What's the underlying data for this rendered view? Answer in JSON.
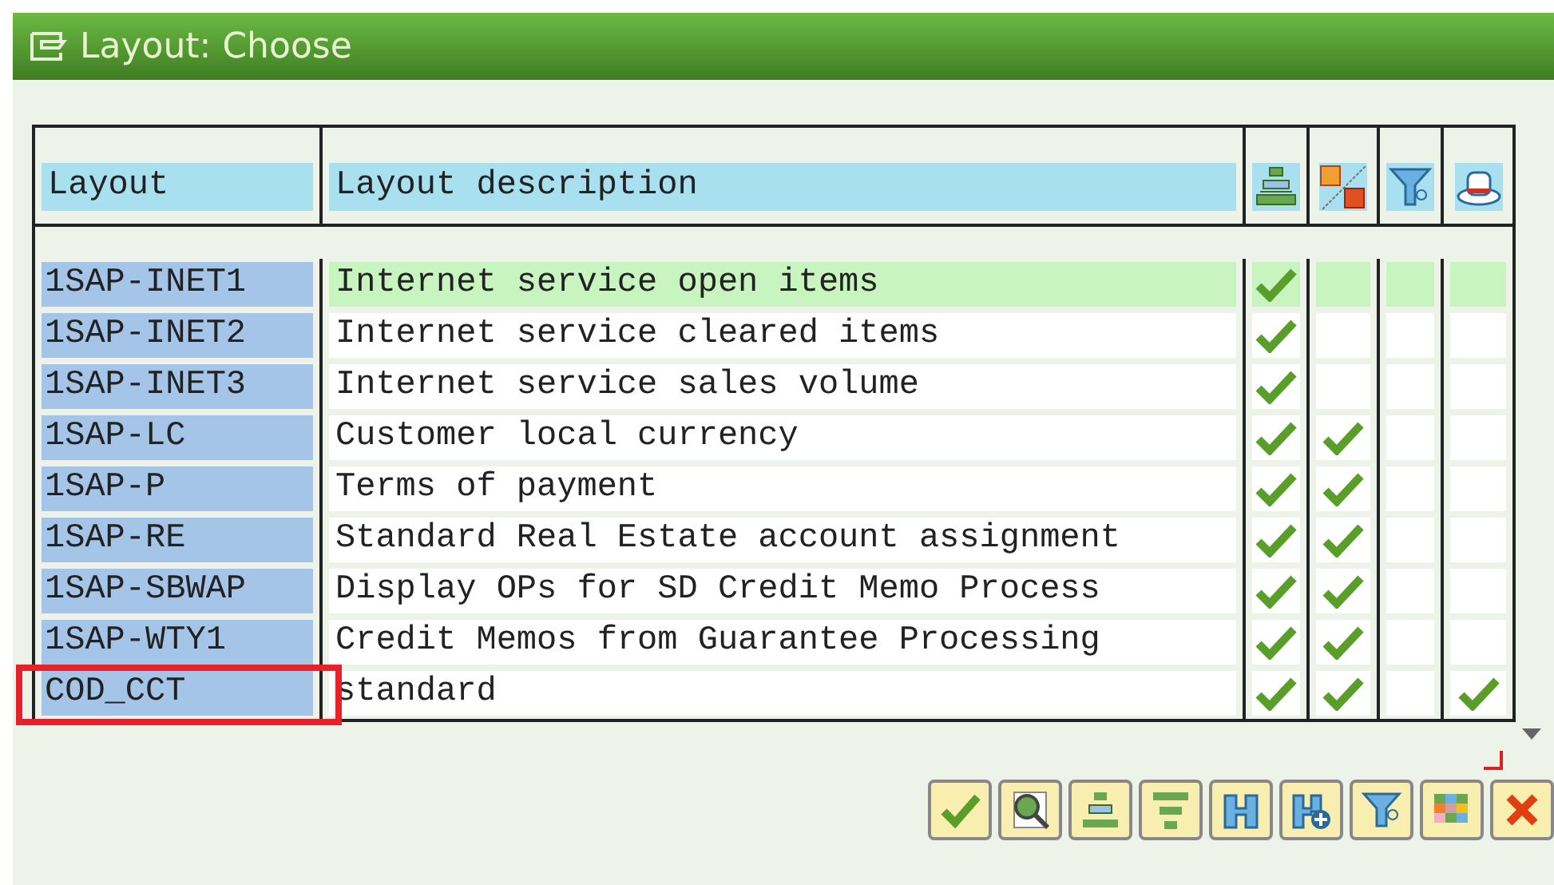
{
  "window": {
    "title": "Layout: Choose"
  },
  "table": {
    "columns": [
      "Layout",
      "Layout description"
    ],
    "rows": [
      {
        "layout": "1SAP-INET1",
        "description": "Internet service open items",
        "selected": true,
        "marked": false,
        "checks": [
          true,
          false,
          false,
          false
        ]
      },
      {
        "layout": "1SAP-INET2",
        "description": "Internet service cleared items",
        "selected": false,
        "marked": false,
        "checks": [
          true,
          false,
          false,
          false
        ]
      },
      {
        "layout": "1SAP-INET3",
        "description": "Internet service sales volume",
        "selected": false,
        "marked": false,
        "checks": [
          true,
          false,
          false,
          false
        ]
      },
      {
        "layout": "1SAP-LC",
        "description": "Customer local currency",
        "selected": false,
        "marked": false,
        "checks": [
          true,
          true,
          false,
          false
        ]
      },
      {
        "layout": "1SAP-P",
        "description": "Terms of payment",
        "selected": false,
        "marked": false,
        "checks": [
          true,
          true,
          false,
          false
        ]
      },
      {
        "layout": "1SAP-RE",
        "description": "Standard Real Estate account assignment",
        "selected": false,
        "marked": false,
        "checks": [
          true,
          true,
          false,
          false
        ]
      },
      {
        "layout": "1SAP-SBWAP",
        "description": "Display OPs for SD Credit Memo Process",
        "selected": false,
        "marked": false,
        "checks": [
          true,
          true,
          false,
          false
        ]
      },
      {
        "layout": "1SAP-WTY1",
        "description": "Credit Memos from Guarantee Processing",
        "selected": false,
        "marked": false,
        "checks": [
          true,
          true,
          false,
          false
        ]
      },
      {
        "layout": "COD_CCT",
        "description": "standard",
        "selected": false,
        "marked": true,
        "checks": [
          true,
          true,
          false,
          true
        ]
      }
    ]
  }
}
